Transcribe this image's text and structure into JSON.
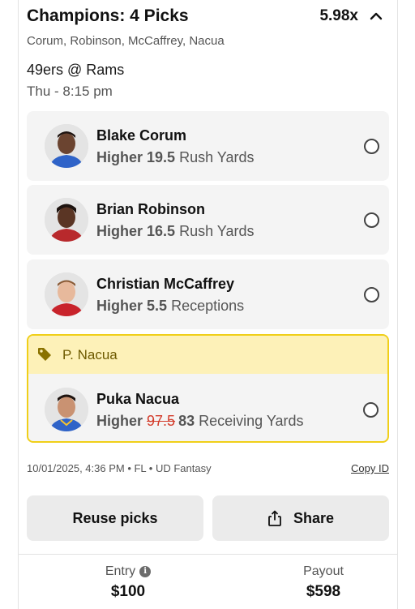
{
  "header": {
    "title": "Champions: 4 Picks",
    "multiplier": "5.98x",
    "subtitle": "Corum, Robinson, McCaffrey, Nacua"
  },
  "game": {
    "matchup": "49ers @ Rams",
    "time": "Thu - 8:15 pm"
  },
  "picks": [
    {
      "name": "Blake Corum",
      "direction": "Higher",
      "line": "19.5",
      "stat": "Rush Yards",
      "jersey_color": "#2f63c8"
    },
    {
      "name": "Brian Robinson",
      "direction": "Higher",
      "line": "16.5",
      "stat": "Rush Yards",
      "jersey_color": "#b8292c"
    },
    {
      "name": "Christian McCaffrey",
      "direction": "Higher",
      "line": "5.5",
      "stat": "Receptions",
      "jersey_color": "#c8232b"
    }
  ],
  "promo": {
    "label": "P. Nacua",
    "highlight_color": "#fdf1b8",
    "border_color": "#f0cf19",
    "pick": {
      "name": "Puka Nacua",
      "direction": "Higher",
      "old_line": "97.5",
      "line": "83",
      "stat": "Receiving Yards",
      "jersey_color": "#2f63c8"
    }
  },
  "meta": {
    "info": "10/01/2025, 4:36 PM • FL • UD Fantasy",
    "copy_label": "Copy ID"
  },
  "actions": {
    "reuse_label": "Reuse picks",
    "share_label": "Share"
  },
  "footer": {
    "entry_label": "Entry",
    "entry_value": "$100",
    "payout_label": "Payout",
    "payout_value": "$598"
  },
  "icons": [
    "chevron-up-icon",
    "tag-icon",
    "share-icon",
    "info-icon",
    "radio-icon"
  ]
}
